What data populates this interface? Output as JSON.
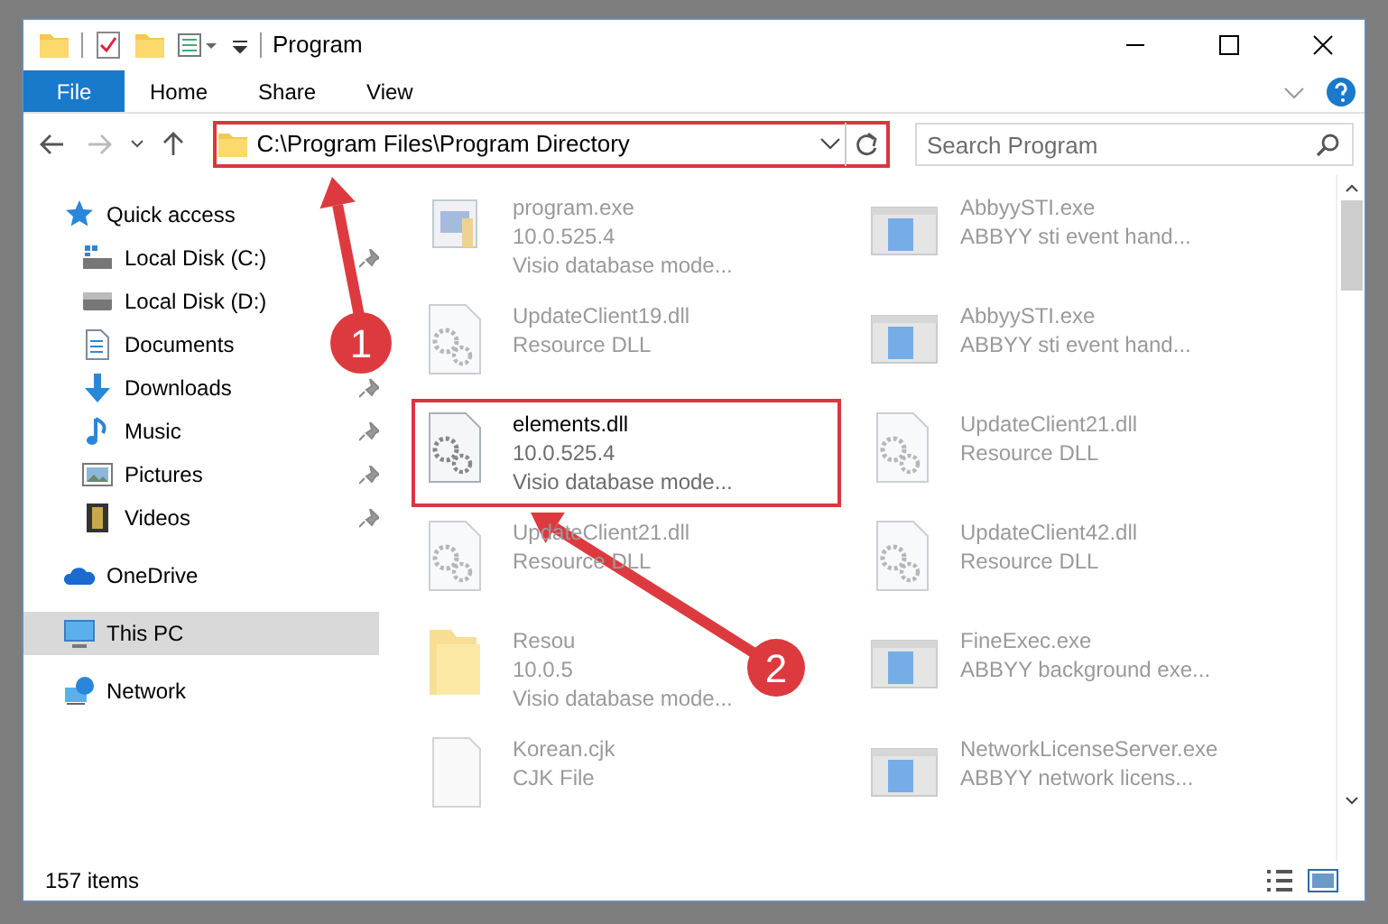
{
  "window": {
    "title": "Program"
  },
  "ribbon_tabs": [
    {
      "label": "File",
      "kind": "file"
    },
    {
      "label": "Home",
      "kind": "tab"
    },
    {
      "label": "Share",
      "kind": "tab"
    },
    {
      "label": "View",
      "kind": "tab"
    }
  ],
  "address_bar": {
    "path": "C:\\Program Files\\Program Directory",
    "highlighted": true
  },
  "search": {
    "placeholder": "Search Program"
  },
  "sidebar": {
    "items": [
      {
        "label": "Quick access",
        "kind": "star",
        "selected": false,
        "children": [
          {
            "label": "Local Disk (C:)",
            "kind": "disk-c",
            "pinned": true,
            "selected": false
          },
          {
            "label": "Local Disk (D:)",
            "kind": "disk",
            "pinned": false,
            "selected": false
          },
          {
            "label": "Documents",
            "kind": "document",
            "pinned": false,
            "selected": false
          },
          {
            "label": "Downloads",
            "kind": "download",
            "pinned": true,
            "selected": false
          },
          {
            "label": "Music",
            "kind": "music",
            "pinned": true,
            "selected": false
          },
          {
            "label": "Pictures",
            "kind": "pictures",
            "pinned": true,
            "selected": false
          },
          {
            "label": "Videos",
            "kind": "videos",
            "pinned": true,
            "selected": false
          }
        ]
      },
      {
        "label": "OneDrive",
        "kind": "cloud",
        "selected": false
      },
      {
        "label": "This PC",
        "kind": "pc",
        "selected": true
      },
      {
        "label": "Network",
        "kind": "network",
        "selected": false
      }
    ]
  },
  "files": [
    {
      "kind": "program",
      "lines": [
        "program.exe",
        "10.0.525.4",
        "Visio database mode..."
      ],
      "highlighted": false,
      "faded": true
    },
    {
      "kind": "window",
      "lines": [
        "AbbyySTI.exe",
        "ABBYY sti event hand..."
      ],
      "highlighted": false,
      "faded": true
    },
    {
      "kind": "dll",
      "lines": [
        "UpdateClient19.dll",
        "Resource DLL"
      ],
      "highlighted": false,
      "faded": true
    },
    {
      "kind": "window",
      "lines": [
        "AbbyySTI.exe",
        "ABBYY sti event hand..."
      ],
      "highlighted": false,
      "faded": true
    },
    {
      "kind": "dll",
      "lines": [
        "elements.dll",
        "10.0.525.4",
        "Visio database mode..."
      ],
      "highlighted": true,
      "faded": false
    },
    {
      "kind": "dll",
      "lines": [
        "UpdateClient21.dll",
        "Resource DLL"
      ],
      "highlighted": false,
      "faded": true
    },
    {
      "kind": "dll",
      "lines": [
        "UpdateClient21.dll",
        "Resource DLL"
      ],
      "highlighted": false,
      "faded": true
    },
    {
      "kind": "dll",
      "lines": [
        "UpdateClient42.dll",
        "Resource DLL"
      ],
      "highlighted": false,
      "faded": true
    },
    {
      "kind": "folder",
      "lines": [
        "Resou",
        "10.0.5",
        "Visio database mode..."
      ],
      "highlighted": false,
      "faded": true
    },
    {
      "kind": "window",
      "lines": [
        "FineExec.exe",
        "ABBYY background exe..."
      ],
      "highlighted": false,
      "faded": true
    },
    {
      "kind": "blank",
      "lines": [
        "Korean.cjk",
        "CJK File"
      ],
      "highlighted": false,
      "faded": true
    },
    {
      "kind": "window",
      "lines": [
        "NetworkLicenseServer.exe",
        "ABBYY network licens..."
      ],
      "highlighted": false,
      "faded": true
    }
  ],
  "status_bar": {
    "count": "157 items"
  },
  "callouts": [
    {
      "number": "1"
    },
    {
      "number": "2"
    }
  ]
}
